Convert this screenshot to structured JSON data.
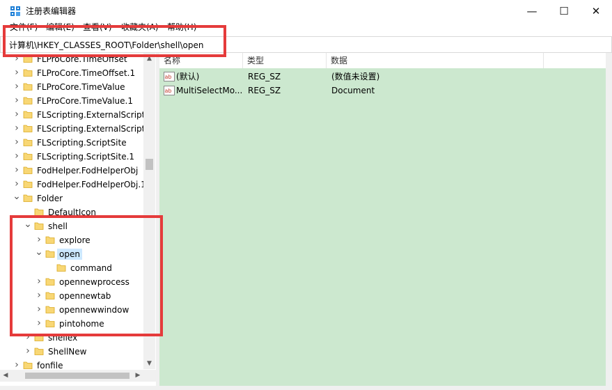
{
  "window": {
    "title": "注册表编辑器",
    "minimize_glyph": "—",
    "maximize_glyph": "☐",
    "close_glyph": "✕"
  },
  "menu": [
    "文件(F)",
    "编辑(E)",
    "查看(V)",
    "收藏夹(A)",
    "帮助(H)"
  ],
  "address": "计算机\\HKEY_CLASSES_ROOT\\Folder\\shell\\open",
  "tree": [
    {
      "label": "FLProCore.TimeOffset",
      "expanded": false
    },
    {
      "label": "FLProCore.TimeOffset.1",
      "expanded": false
    },
    {
      "label": "FLProCore.TimeValue",
      "expanded": false
    },
    {
      "label": "FLProCore.TimeValue.1",
      "expanded": false
    },
    {
      "label": "FLScripting.ExternalScriptP",
      "expanded": false
    },
    {
      "label": "FLScripting.ExternalScriptP",
      "expanded": false
    },
    {
      "label": "FLScripting.ScriptSite",
      "expanded": false
    },
    {
      "label": "FLScripting.ScriptSite.1",
      "expanded": false
    },
    {
      "label": "FodHelper.FodHelperObj",
      "expanded": false
    },
    {
      "label": "FodHelper.FodHelperObj.1",
      "expanded": false
    },
    {
      "label": "Folder",
      "expanded": true
    },
    {
      "label": "DefaultIcon",
      "expanded": null
    },
    {
      "label": "shell",
      "expanded": true
    },
    {
      "label": "explore",
      "expanded": false
    },
    {
      "label": "open",
      "expanded": true,
      "selected": true
    },
    {
      "label": "command",
      "expanded": null
    },
    {
      "label": "opennewprocess",
      "expanded": false
    },
    {
      "label": "opennewtab",
      "expanded": false
    },
    {
      "label": "opennewwindow",
      "expanded": false
    },
    {
      "label": "pintohome",
      "expanded": false
    },
    {
      "label": "shellex",
      "expanded": false
    },
    {
      "label": "ShellNew",
      "expanded": false
    },
    {
      "label": "fonfile",
      "expanded": false
    }
  ],
  "list": {
    "headers": [
      "名称",
      "类型",
      "数据"
    ],
    "rows": [
      {
        "name": "(默认)",
        "type": "REG_SZ",
        "data": "(数值未设置)"
      },
      {
        "name": "MultiSelectMo...",
        "type": "REG_SZ",
        "data": "Document"
      }
    ]
  },
  "colors": {
    "highlight_box": "#e53b3b",
    "list_background": "#cce8cf",
    "selection": "#cce8ff",
    "folder": "#f8d775"
  },
  "icons": {
    "app": "regedit-icon",
    "folder": "folder-icon",
    "value": "string-value-icon"
  }
}
